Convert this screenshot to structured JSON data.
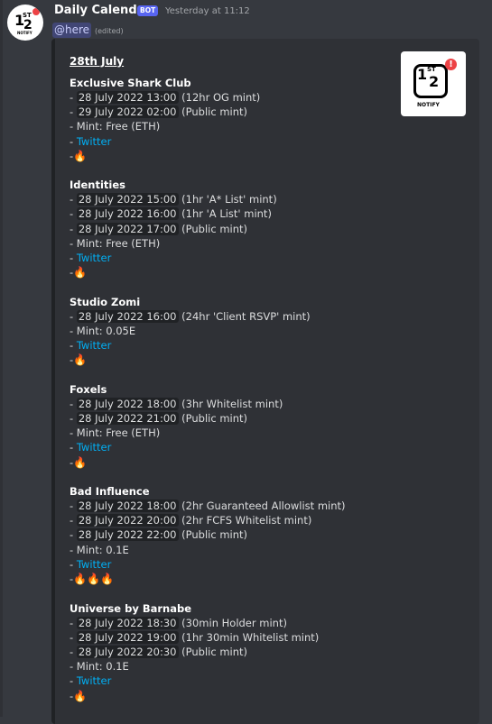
{
  "message": {
    "username": "Daily Calendar",
    "bot_tag": "BOT",
    "timestamp": "Yesterday at 11:12",
    "mention": "@here",
    "edited": "(edited)"
  },
  "avatar": {
    "text_1": "1",
    "text_st": "ST",
    "text_2": "2",
    "text_notify": "NOTIFY"
  },
  "thumbnail": {
    "text_1": "1",
    "text_st": "ST",
    "text_2": "2",
    "text_notify": "NOTIFY",
    "badge": "!"
  },
  "embed": {
    "date_title": "28th July",
    "projects": [
      {
        "name": "Exclusive Shark Club",
        "mints": [
          {
            "time": "28 July 2022 13:00",
            "note": " (12hr OG mint)"
          },
          {
            "time": "29 July 2022 02:00",
            "note": " (Public mint)"
          }
        ],
        "mint_price": "- Mint: Free (ETH)",
        "twitter": "Twitter",
        "fire": "🔥"
      },
      {
        "name": "Identities",
        "mints": [
          {
            "time": "28 July 2022 15:00",
            "note": " (1hr 'A* List' mint)"
          },
          {
            "time": "28 July 2022 16:00",
            "note": " (1hr 'A List' mint)"
          },
          {
            "time": "28 July 2022 17:00",
            "note": " (Public mint)"
          }
        ],
        "mint_price": "- Mint: Free (ETH)",
        "twitter": "Twitter",
        "fire": "🔥"
      },
      {
        "name": "Studio Zomi",
        "mints": [
          {
            "time": "28 July 2022 16:00",
            "note": " (24hr 'Client RSVP' mint)"
          }
        ],
        "mint_price": "- Mint: 0.05E",
        "twitter": "Twitter",
        "fire": "🔥"
      },
      {
        "name": "Foxels",
        "mints": [
          {
            "time": "28 July 2022 18:00",
            "note": " (3hr Whitelist mint)"
          },
          {
            "time": "28 July 2022 21:00",
            "note": " (Public mint)"
          }
        ],
        "mint_price": "- Mint: Free (ETH)",
        "twitter": "Twitter",
        "fire": "🔥"
      },
      {
        "name": "Bad Influence",
        "mints": [
          {
            "time": "28 July 2022 18:00",
            "note": " (2hr Guaranteed Allowlist mint)"
          },
          {
            "time": "28 July 2022 20:00",
            "note": " (2hr FCFS Whitelist mint)"
          },
          {
            "time": "28 July 2022 22:00",
            "note": " (Public mint)"
          }
        ],
        "mint_price": "- Mint: 0.1E",
        "twitter": "Twitter",
        "fire": "🔥🔥🔥"
      },
      {
        "name": "Universe by Barnabe",
        "mints": [
          {
            "time": "28 July 2022 18:30",
            "note": " (30min Holder mint)"
          },
          {
            "time": "28 July 2022 19:00",
            "note": " (1hr 30min Whitelist mint)"
          },
          {
            "time": "28 July 2022 20:30",
            "note": " (Public mint)"
          }
        ],
        "mint_price": "- Mint: 0.1E",
        "twitter": "Twitter",
        "fire": "🔥"
      }
    ]
  }
}
